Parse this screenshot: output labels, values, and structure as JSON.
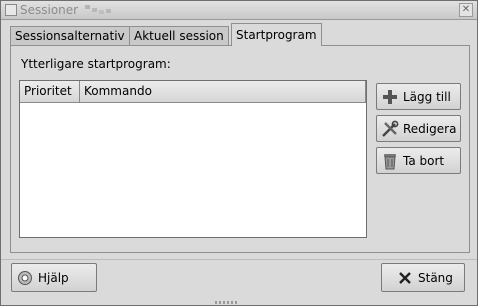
{
  "window": {
    "title": "Sessioner",
    "close_glyph": "✕"
  },
  "tabs": [
    {
      "label": "Sessionsalternativ",
      "active": false
    },
    {
      "label": "Aktuell session",
      "active": false
    },
    {
      "label": "Startprogram",
      "active": true
    }
  ],
  "startup": {
    "section_label": "Ytterligare startprogram:",
    "columns": [
      "Prioritet",
      "Kommando"
    ],
    "rows": []
  },
  "actions": {
    "add_label": "Lägg till",
    "edit_label": "Redigera",
    "remove_label": "Ta bort"
  },
  "footer": {
    "help_label": "Hjälp",
    "close_label": "Stäng"
  },
  "icons": {
    "add": "plus-icon",
    "edit": "tools-icon",
    "remove": "trash-icon",
    "help": "lifebuoy-icon",
    "close": "x-icon"
  }
}
